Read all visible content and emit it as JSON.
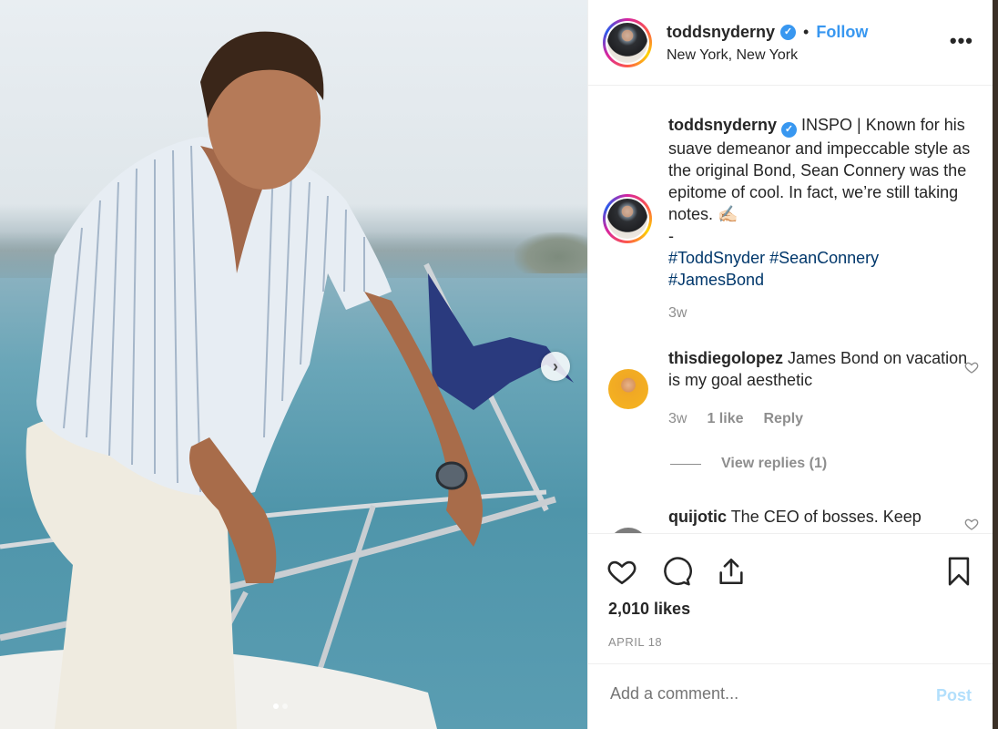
{
  "post": {
    "username": "toddsnyderny",
    "follow_label": "Follow",
    "separator": "•",
    "location": "New York, New York",
    "more_label": "•••",
    "verified_mark": "✓"
  },
  "caption": {
    "username": "toddsnyderny",
    "text": "INSPO | Known for his suave demeanor and impeccable style as the original Bond, Sean Connery was the epitome of cool. In fact, we’re still taking notes. ✍🏻",
    "dash": "-",
    "hashtags": [
      "#ToddSnyder",
      "#SeanConnery",
      "#JamesBond"
    ],
    "age": "3w"
  },
  "comments": [
    {
      "username": "thisdiegolopez",
      "text": "James Bond on vacation is my goal aesthetic",
      "age": "3w",
      "likes": "1 like",
      "reply_label": "Reply",
      "view_replies": "View replies (1)"
    },
    {
      "username": "quijotic",
      "text": "The CEO of bosses. Keep"
    }
  ],
  "footer": {
    "likes": "2,010 likes",
    "date": "APRIL 18",
    "comment_placeholder": "Add a comment...",
    "post_label": "Post"
  },
  "icons": [
    "heart-icon",
    "comment-icon",
    "share-icon",
    "bookmark-icon",
    "chevron-right-icon",
    "verified-icon",
    "more-icon"
  ],
  "colors": {
    "accent": "#3897f0",
    "hashtag": "#00376b",
    "muted": "#8e8e8e",
    "post_disabled": "#b2dffc"
  }
}
